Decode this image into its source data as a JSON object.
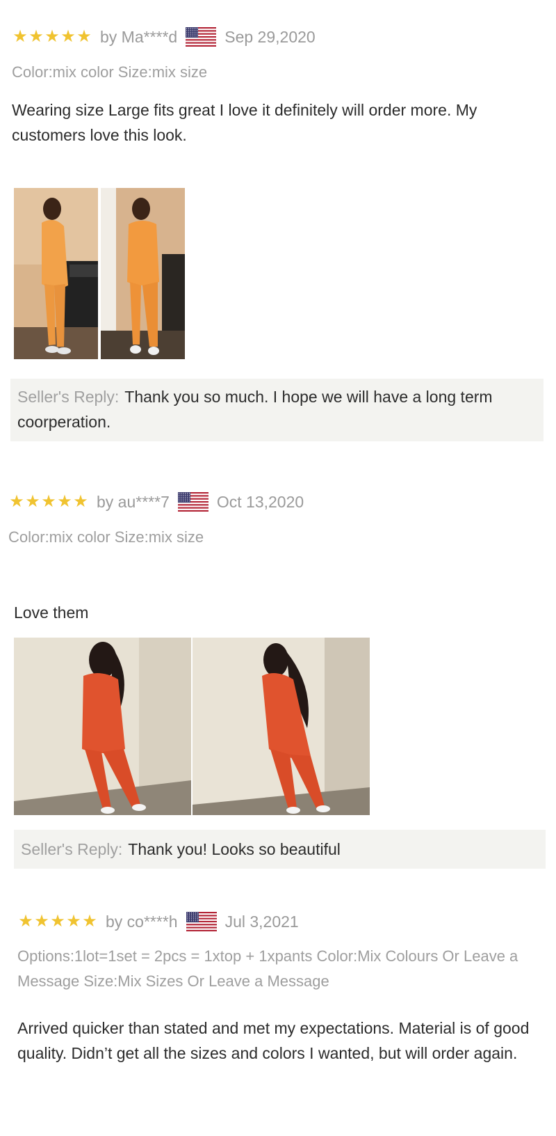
{
  "reviews": [
    {
      "rating": 5,
      "stars": [
        "★",
        "★",
        "★",
        "★",
        "★"
      ],
      "author": "by Ma****d",
      "country_flag": "us-flag",
      "date": "Sep 29,2020",
      "options": "Color:mix color Size:mix size",
      "text": "Wearing size Large fits great I love it definitely will order more. My customers love this look.",
      "photos": [
        "review-photo-orange-tracksuit-side",
        "review-photo-orange-tracksuit-front"
      ],
      "reply_label": "Seller's Reply:",
      "reply_text": "Thank you so much. I hope we will have a long term coorperation."
    },
    {
      "rating": 5,
      "stars": [
        "★",
        "★",
        "★",
        "★",
        "★"
      ],
      "author": "by au****7",
      "country_flag": "us-flag",
      "date": "Oct 13,2020",
      "options": "Color:mix color Size:mix size",
      "text": "Love them",
      "photos": [
        "review-photo-red-tracksuit-front",
        "review-photo-red-tracksuit-side"
      ],
      "reply_label": "Seller's Reply:",
      "reply_text": "Thank you! Looks so beautiful"
    },
    {
      "rating": 5,
      "stars": [
        "★",
        "★",
        "★",
        "★",
        "★"
      ],
      "author": "by co****h",
      "country_flag": "us-flag",
      "date": "Jul 3,2021",
      "options": "Options:1lot=1set = 2pcs = 1xtop + 1xpants Color:Mix Colours Or Leave a Message Size:Mix Sizes Or Leave a Message",
      "text": "Arrived quicker than stated and met my expectations. Material is of good quality. Didn’t get all the sizes and colors I wanted, but will order again."
    }
  ],
  "colors": {
    "star": "#f0c330",
    "muted_text": "#9a9a9a",
    "reply_bg": "#f3f3f0",
    "body_text": "#2b2b2b"
  }
}
